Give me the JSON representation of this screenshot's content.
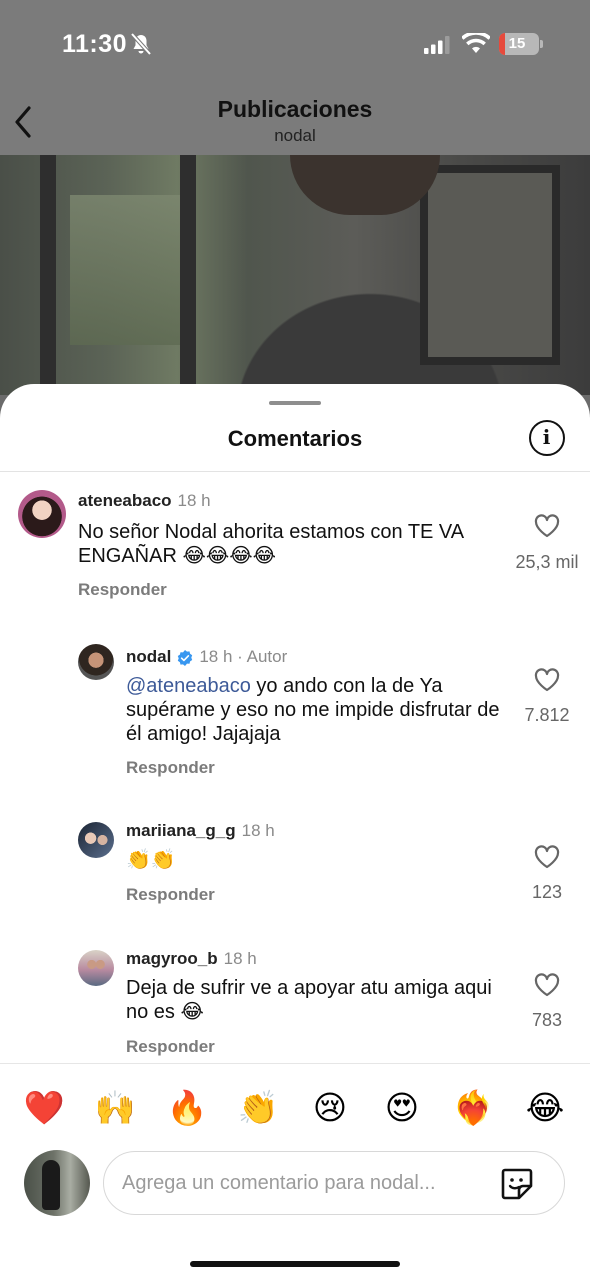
{
  "status_bar": {
    "time": "11:30",
    "battery": "15",
    "battery_level": 0.15
  },
  "header": {
    "title": "Publicaciones",
    "subtitle": "nodal"
  },
  "comments_sheet": {
    "title": "Comentarios"
  },
  "comments": [
    {
      "username": "ateneabaco",
      "time": "18 h",
      "text": "No señor Nodal ahorita estamos con TE VA ENGAÑAR 😂😂😂😂",
      "reply_label": "Responder",
      "likes": "25,3 mil"
    },
    {
      "username": "nodal",
      "time": "18 h · Autor",
      "mention": "@ateneabaco",
      "text": " yo ando con la de Ya supérame y eso no me impide disfrutar de él amigo! Jajajaja",
      "reply_label": "Responder",
      "likes": "7.812",
      "verified": true
    },
    {
      "username": "mariiana_g_g",
      "time": "18 h",
      "text": "👏👏",
      "reply_label": "Responder",
      "likes": "123"
    },
    {
      "username": "magyroo_b",
      "time": "18 h",
      "text": "Deja de sufrir ve a apoyar atu amiga aqui no es 😂",
      "reply_label": "Responder",
      "likes": "783"
    }
  ],
  "quick_reactions": [
    "❤️",
    "🙌",
    "🔥",
    "👏",
    "😢",
    "😍",
    "❤️‍🔥",
    "😂"
  ],
  "composer": {
    "placeholder": "Agrega un comentario para nodal..."
  },
  "colors": {
    "accent_link": "#3d5a98",
    "verified": "#3897f0",
    "battery_low": "#e64a3c"
  },
  "icons": [
    "bell-slash-icon",
    "cellular-signal-icon",
    "wifi-icon",
    "battery-icon",
    "chevron-left-icon",
    "info-icon",
    "heart-outline-icon",
    "verified-badge-icon",
    "sticker-icon"
  ]
}
